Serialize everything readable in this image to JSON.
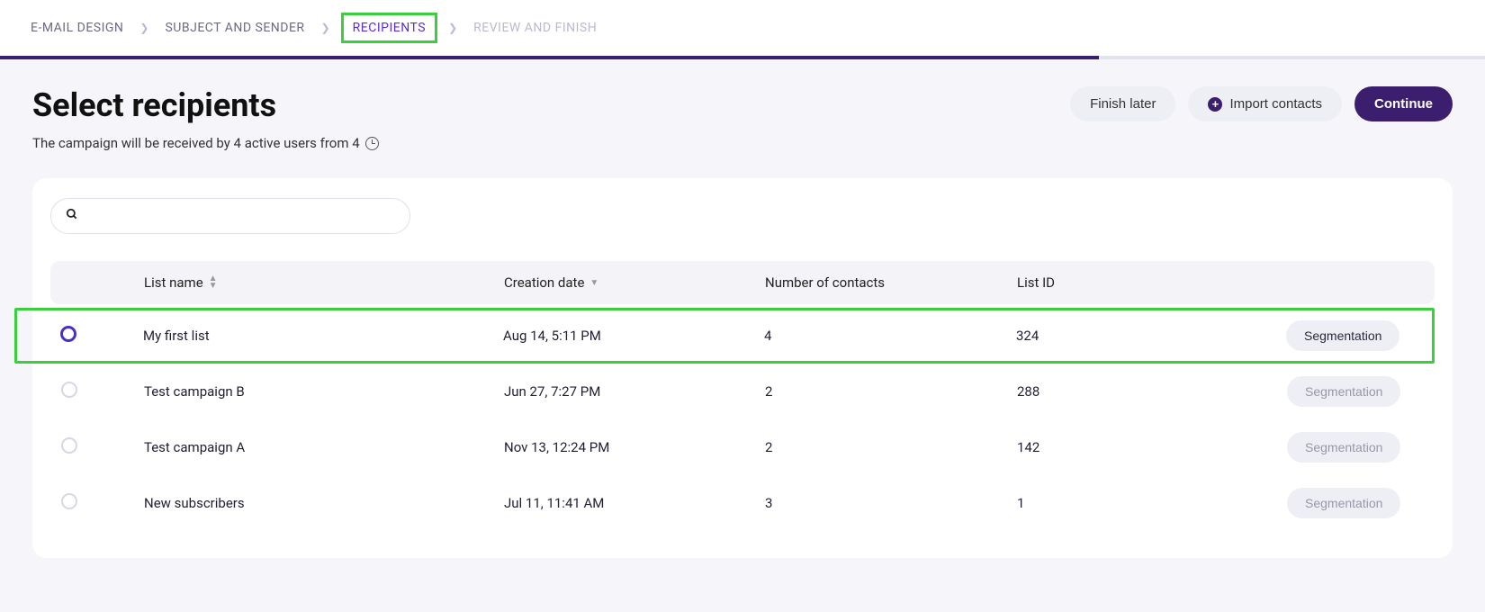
{
  "breadcrumb": {
    "items": [
      {
        "label": "E-MAIL DESIGN",
        "state": "done"
      },
      {
        "label": "SUBJECT AND SENDER",
        "state": "done"
      },
      {
        "label": "RECIPIENTS",
        "state": "active"
      },
      {
        "label": "REVIEW AND FINISH",
        "state": "upcoming"
      }
    ]
  },
  "header": {
    "title": "Select recipients",
    "subtitle": "The campaign will be received by 4 active users from 4"
  },
  "actions": {
    "finish_later": "Finish later",
    "import_contacts": "Import contacts",
    "continue": "Continue"
  },
  "search": {
    "placeholder": ""
  },
  "columns": {
    "list_name": "List name",
    "creation_date": "Creation date",
    "contacts": "Number of contacts",
    "list_id": "List ID"
  },
  "rows": [
    {
      "name": "My first list",
      "date": "Aug 14, 5:11 PM",
      "contacts": "4",
      "id": "324",
      "selected": true,
      "seg_active": true,
      "seg_label": "Segmentation"
    },
    {
      "name": "Test campaign B",
      "date": "Jun 27, 7:27 PM",
      "contacts": "2",
      "id": "288",
      "selected": false,
      "seg_active": false,
      "seg_label": "Segmentation"
    },
    {
      "name": "Test campaign A",
      "date": "Nov 13, 12:24 PM",
      "contacts": "2",
      "id": "142",
      "selected": false,
      "seg_active": false,
      "seg_label": "Segmentation"
    },
    {
      "name": "New subscribers",
      "date": "Jul 11, 11:41 AM",
      "contacts": "3",
      "id": "1",
      "selected": false,
      "seg_active": false,
      "seg_label": "Segmentation"
    }
  ]
}
